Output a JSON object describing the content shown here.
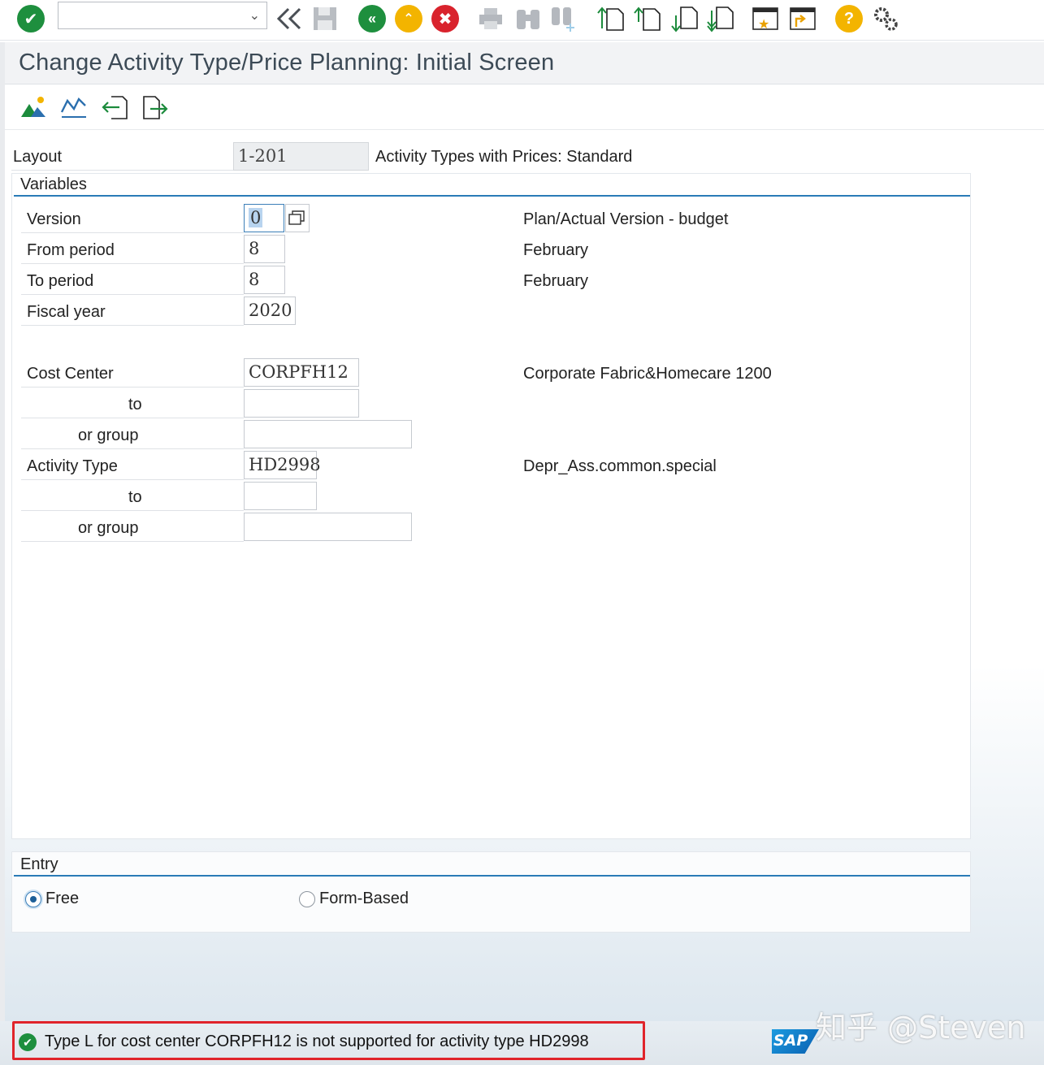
{
  "toolbar": {
    "command_field_value": "",
    "icons": [
      "enter-check-icon",
      "command-dropdown-icon",
      "back-double-chevron-icon",
      "save-icon",
      "back-icon",
      "exit-icon",
      "cancel-icon",
      "print-icon",
      "find-icon",
      "find-next-icon",
      "first-page-icon",
      "previous-page-icon",
      "next-page-icon",
      "last-page-icon",
      "create-session-icon",
      "create-shortcut-icon",
      "help-icon",
      "settings-gear-icon"
    ]
  },
  "title": "Change Activity Type/Price Planning: Initial Screen",
  "app_toolbar": {
    "icons": [
      "overview-icon",
      "line-chart-icon",
      "import-icon",
      "export-icon"
    ]
  },
  "layout": {
    "label": "Layout",
    "value": "1-201",
    "description": "Activity Types with Prices: Standard"
  },
  "variables": {
    "title": "Variables",
    "version": {
      "label": "Version",
      "value": "0",
      "description": "Plan/Actual Version -  budget"
    },
    "from_period": {
      "label": "From period",
      "value": "8",
      "description": "February"
    },
    "to_period": {
      "label": "To period",
      "value": "8",
      "description": "February"
    },
    "fiscal_year": {
      "label": "Fiscal year",
      "value": "2020"
    },
    "cost_center": {
      "label": "Cost Center",
      "value": "CORPFH12",
      "description": "Corporate Fabric&Homecare 1200"
    },
    "cost_center_to": {
      "label": "to",
      "value": ""
    },
    "cost_center_group": {
      "label": "or group",
      "value": ""
    },
    "activity_type": {
      "label": "Activity Type",
      "value": "HD2998",
      "description": "Depr_Ass.common.special"
    },
    "activity_type_to": {
      "label": "to",
      "value": ""
    },
    "activity_type_group": {
      "label": "or group",
      "value": ""
    }
  },
  "entry": {
    "title": "Entry",
    "options": [
      {
        "label": "Free",
        "selected": true
      },
      {
        "label": "Form-Based",
        "selected": false
      }
    ]
  },
  "status": {
    "message": "Type L for cost center CORPFH12 is not supported for activity type HD2998",
    "logo": "SAP",
    "watermark": "知乎 @Steven"
  },
  "colors": {
    "accent_blue": "#2a7bb7",
    "success_green": "#1e8f3e",
    "warning_yellow": "#f3b400",
    "cancel_red": "#d9232d",
    "highlight_red": "#e0242b"
  }
}
